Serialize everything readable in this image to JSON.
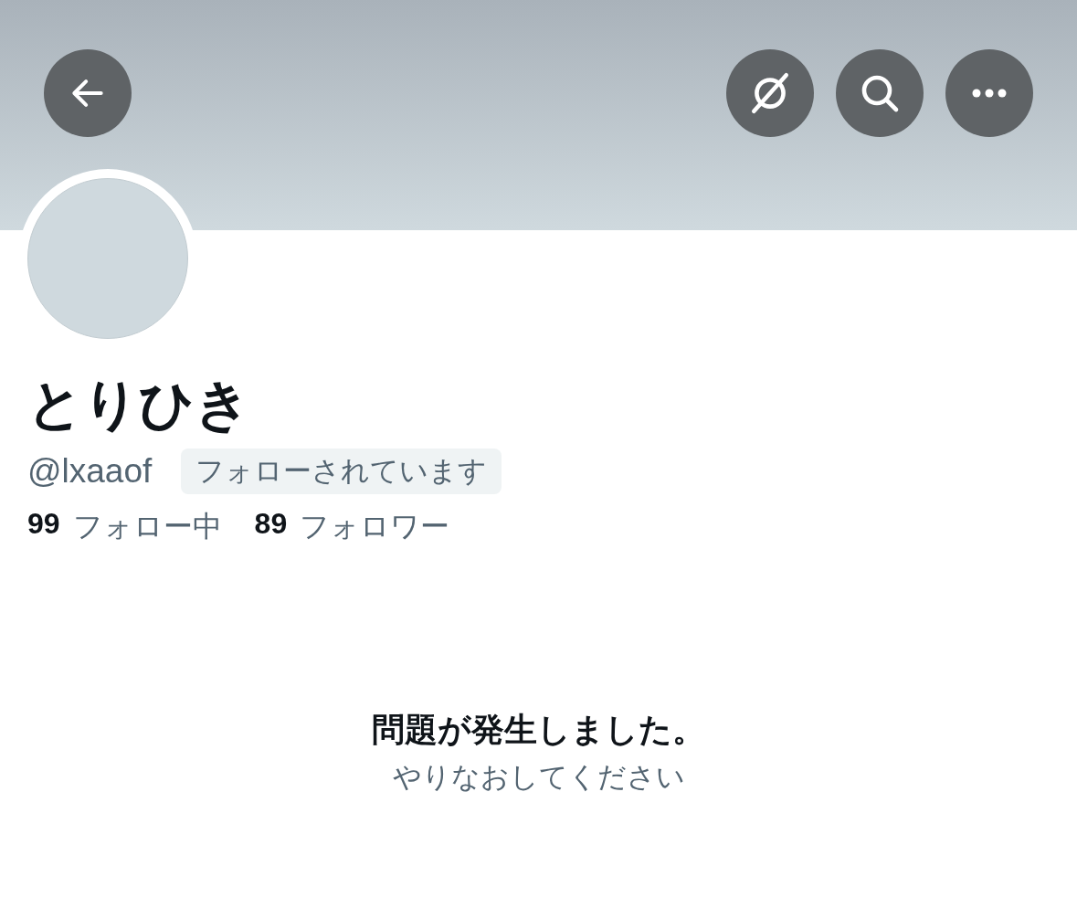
{
  "header": {
    "buttons": [
      {
        "kind": "back"
      },
      {
        "kind": "slashed-circle"
      },
      {
        "kind": "search"
      },
      {
        "kind": "more"
      }
    ]
  },
  "profile": {
    "name": "とりひき",
    "handle": "@lxaaof",
    "follows_you_badge": "フォローされています",
    "stats": [
      {
        "count": "99",
        "label": "フォロー中"
      },
      {
        "count": "89",
        "label": "フォロワー"
      }
    ]
  },
  "error": {
    "title": "問題が発生しました。",
    "message": "やりなおしてください"
  }
}
